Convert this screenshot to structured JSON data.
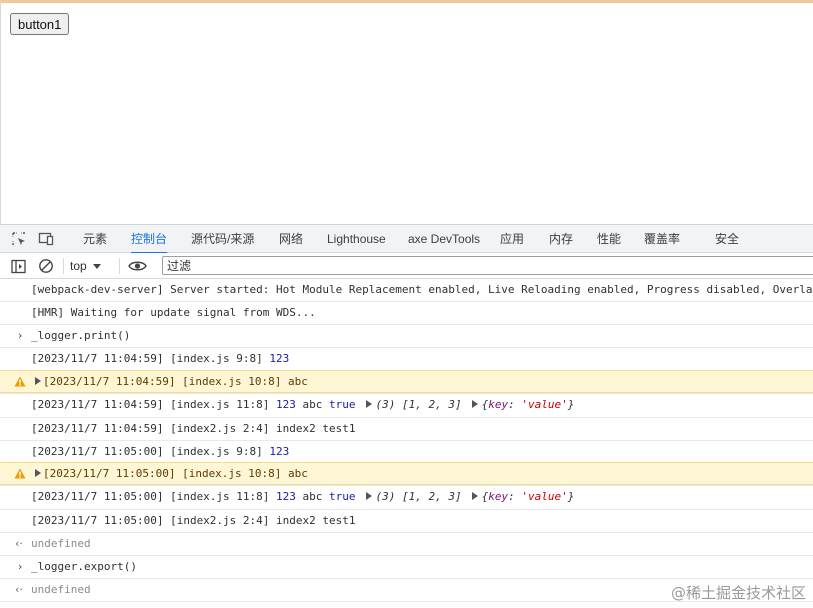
{
  "page": {
    "button_label": "button1"
  },
  "devtools": {
    "tabs": [
      {
        "label": "元素"
      },
      {
        "label": "控制台",
        "active": true
      },
      {
        "label": "源代码/来源"
      },
      {
        "label": "网络"
      },
      {
        "label": "Lighthouse"
      },
      {
        "label": "axe DevTools"
      },
      {
        "label": "应用"
      },
      {
        "label": "内存"
      },
      {
        "label": "性能"
      },
      {
        "label": "覆盖率"
      },
      {
        "label": "安全"
      }
    ],
    "toolbar": {
      "context": "top",
      "filter_placeholder": "过滤"
    },
    "colors": {
      "accent": "#1a73e8",
      "warning_bg": "#fef6d5",
      "warning_icon": "#e8a000"
    },
    "icons": [
      "inspect-element-icon",
      "device-toolbar-icon",
      "sidebar-toggle-icon",
      "clear-console-icon",
      "dropdown-caret-icon",
      "live-expression-eye-icon",
      "warning-icon",
      "expand-triangle-icon"
    ]
  },
  "console": {
    "line1": "[webpack-dev-server] Server started: Hot Module Replacement enabled, Live Reloading enabled, Progress disabled, Overlay",
    "line2": "[HMR] Waiting for update signal from WDS...",
    "input1": "_logger.print()",
    "l3_text": "[2023/11/7 11:04:59] [index.js 9:8]",
    "l3_num": "123",
    "l4_text": "[2023/11/7 11:04:59] [index.js 10:8] abc",
    "l5_text": "[2023/11/7 11:04:59] [index.js 11:8]",
    "l5_num": "123",
    "l5_abc": "abc",
    "l5_bool": "true",
    "l5_arr": "(3) [1, 2, 3]",
    "l5_key": "key",
    "l5_str": "'value'",
    "l6_text": "[2023/11/7 11:04:59] [index2.js 2:4] index2 test1",
    "l7_text": "[2023/11/7 11:05:00] [index.js 9:8]",
    "l7_num": "123",
    "l8_text": "[2023/11/7 11:05:00] [index.js 10:8] abc",
    "l9_text": "[2023/11/7 11:05:00] [index.js 11:8]",
    "l9_num": "123",
    "l9_abc": "abc",
    "l9_bool": "true",
    "l9_arr": "(3) [1, 2, 3]",
    "l9_key": "key",
    "l9_str": "'value'",
    "l10_text": "[2023/11/7 11:05:00] [index2.js 2:4] index2 test1",
    "result1": "undefined",
    "input2": "_logger.export()",
    "result2": "undefined"
  },
  "watermark": "@稀土掘金技术社区"
}
